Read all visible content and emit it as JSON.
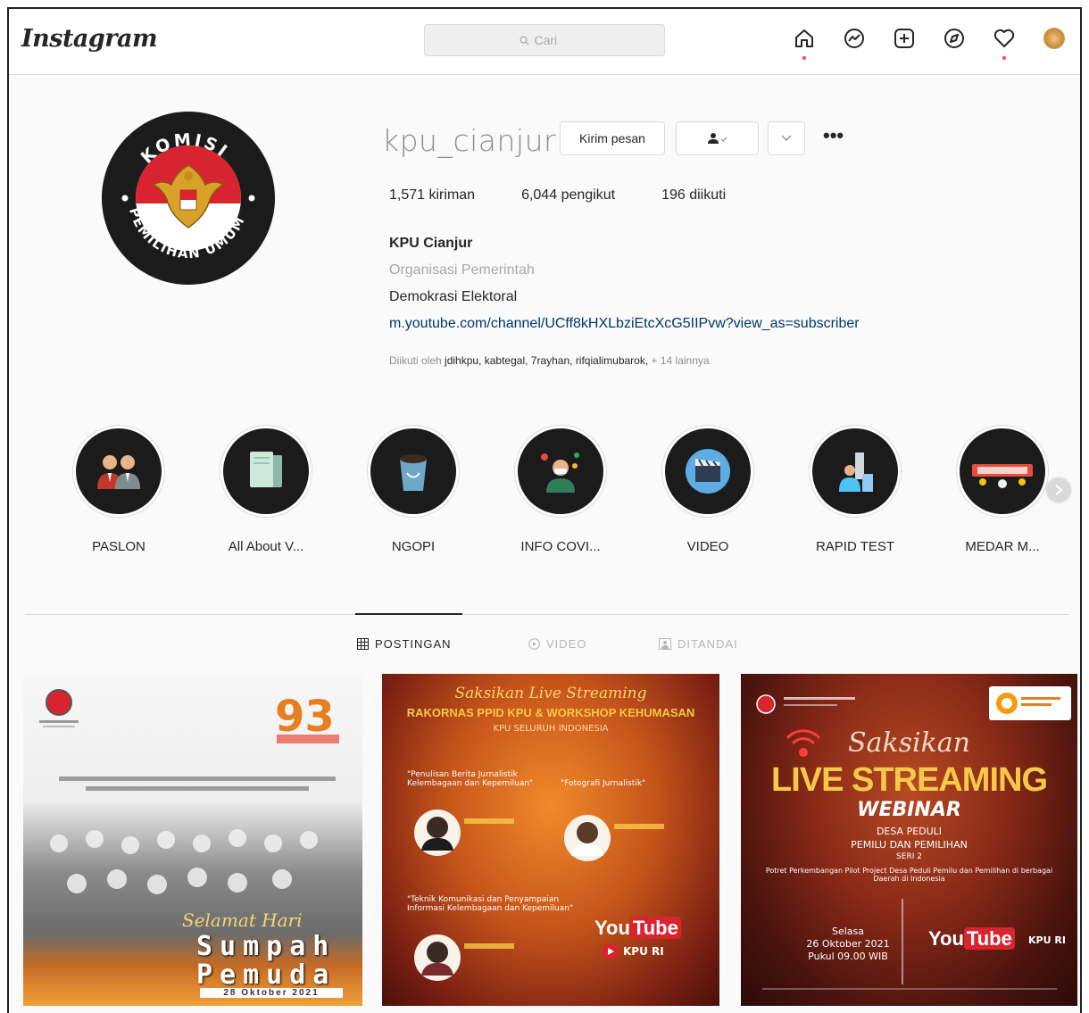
{
  "nav": {
    "logo": "Instagram",
    "search_placeholder": "Cari",
    "icons": [
      "home-icon",
      "messenger-icon",
      "new-post-icon",
      "explore-icon",
      "activity-heart-icon",
      "profile-avatar"
    ]
  },
  "profile": {
    "username": "kpu_cianjur",
    "message_button": "Kirim pesan",
    "follow_icon": "person-check-icon",
    "more": "•••",
    "stats": {
      "posts": "1,571",
      "posts_label": "kiriman",
      "followers": "6,044",
      "followers_label": "pengikut",
      "following": "196",
      "following_label": "diikuti"
    },
    "full_name": "KPU Cianjur",
    "category": "Organisasi Pemerintah",
    "bio": "Demokrasi Elektoral",
    "link": "m.youtube.com/channel/UCff8kHXLbziEtcXcG5IIPvw?view_as=subscriber",
    "followed_by_prefix": "Diikuti oleh",
    "followed_by_names": "jdihkpu, kabtegal, 7rayhan, rifqialimubarok,",
    "followed_by_more": "+ 14 lainnya",
    "logo_text_top": "KOMISI",
    "logo_text_bottom": "PEMILIHAN UMUM"
  },
  "highlights": [
    {
      "label": "PASLON",
      "icon": "people-icon"
    },
    {
      "label": "All About V...",
      "icon": "documents-icon"
    },
    {
      "label": "NGOPI",
      "icon": "coffee-icon"
    },
    {
      "label": "INFO COVI...",
      "icon": "covid-person-icon"
    },
    {
      "label": "VIDEO",
      "icon": "clapperboard-icon"
    },
    {
      "label": "RAPID TEST",
      "icon": "rapid-test-icon"
    },
    {
      "label": "MEDAR M...",
      "icon": "banner-icon"
    }
  ],
  "tabs": {
    "posts": "POSTINGAN",
    "video": "VIDEO",
    "tagged": "DITANDAI"
  },
  "posts": {
    "p1": {
      "anniversary": "93",
      "headline": "Selamat Hari",
      "line1": "Sumpah",
      "line2": "Pemuda",
      "date": "28 Oktober 2021"
    },
    "p2": {
      "script": "Saksikan Live Streaming",
      "title": "RAKORNAS PPID KPU & WORKSHOP KEHUMASAN",
      "subtitle": "KPU SELURUH INDONESIA",
      "topic1": "\"Penulisan Berita Jurnalistik Kelembagaan dan Kepemiluan\"",
      "topic2": "\"Fotografi Jurnalistik\"",
      "topic3": "\"Teknik Komunikasi dan Penyampaian Informasi Kelembagaan dan Kepemiluan\"",
      "yt_you": "You",
      "yt_tube": "Tube",
      "channel": "KPU RI"
    },
    "p3": {
      "script": "Saksikan",
      "title": "LIVE STREAMING",
      "webinar": "WEBINAR",
      "sub1": "DESA PEDULI",
      "sub2": "PEMILU DAN PEMILIHAN",
      "sub3": "SERI 2",
      "desc": "Potret Perkembangan Pilot Project Desa Peduli Pemilu dan Pemilihan di berbagai Daerah di Indonesia",
      "day": "Selasa",
      "date": "26 Oktober 2021",
      "time": "Pukul 09.00 WIB",
      "yt_you": "You",
      "yt_tube": "Tube",
      "channel": "KPU RI"
    }
  },
  "colors": {
    "link": "#00376b",
    "muted": "#8e8e8e",
    "notification": "#ed4956"
  }
}
